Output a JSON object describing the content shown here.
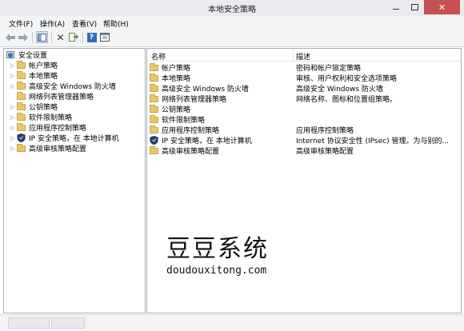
{
  "window": {
    "title": "本地安全策略"
  },
  "menu": [
    {
      "label": "文件(F)"
    },
    {
      "label": "操作(A)"
    },
    {
      "label": "查看(V)"
    },
    {
      "label": "帮助(H)"
    }
  ],
  "toolbar": {
    "icons": [
      "back-arrow-icon",
      "forward-arrow-icon",
      "show-tree-icon",
      "delete-icon",
      "export-icon",
      "help-icon",
      "properties-icon"
    ]
  },
  "tree": {
    "root": "安全设置",
    "items": [
      {
        "label": "帐户策略",
        "expandable": true,
        "icon": "folder-icon"
      },
      {
        "label": "本地策略",
        "expandable": true,
        "icon": "folder-icon"
      },
      {
        "label": "高级安全 Windows 防火墙",
        "expandable": true,
        "icon": "folder-icon"
      },
      {
        "label": "网络列表管理器策略",
        "expandable": false,
        "icon": "folder-icon"
      },
      {
        "label": "公钥策略",
        "expandable": true,
        "icon": "folder-icon"
      },
      {
        "label": "软件限制策略",
        "expandable": true,
        "icon": "folder-icon"
      },
      {
        "label": "应用程序控制策略",
        "expandable": true,
        "icon": "folder-icon"
      },
      {
        "label": "IP 安全策略，在 本地计算机",
        "expandable": true,
        "icon": "ipsec-shield-icon"
      },
      {
        "label": "高级审核策略配置",
        "expandable": true,
        "icon": "folder-icon"
      }
    ]
  },
  "list": {
    "columns": [
      "名称",
      "描述"
    ],
    "rows": [
      {
        "name": "帐户策略",
        "desc": "密码和帐户锁定策略",
        "icon": "folder-icon"
      },
      {
        "name": "本地策略",
        "desc": "审核、用户权利和安全选项策略",
        "icon": "folder-icon"
      },
      {
        "name": "高级安全 Windows 防火墙",
        "desc": "高级安全 Windows 防火墙",
        "icon": "folder-icon"
      },
      {
        "name": "网络列表管理器策略",
        "desc": "网络名称、图标和位置组策略。",
        "icon": "folder-icon"
      },
      {
        "name": "公钥策略",
        "desc": "",
        "icon": "folder-icon"
      },
      {
        "name": "软件限制策略",
        "desc": "",
        "icon": "folder-icon"
      },
      {
        "name": "应用程序控制策略",
        "desc": "应用程序控制策略",
        "icon": "folder-icon"
      },
      {
        "name": "IP 安全策略，在 本地计算机",
        "desc": "Internet 协议安全性 (IPsec) 管理。为与别的...",
        "icon": "ipsec-shield-icon"
      },
      {
        "name": "高级审核策略配置",
        "desc": "高级审核策略配置",
        "icon": "folder-icon"
      }
    ]
  },
  "watermark": {
    "title": "豆豆系统",
    "url": "doudouxitong.com"
  },
  "colors": {
    "close_button": "#c75050",
    "folder": "#e9c66a",
    "chrome": "#f3f4f6"
  }
}
